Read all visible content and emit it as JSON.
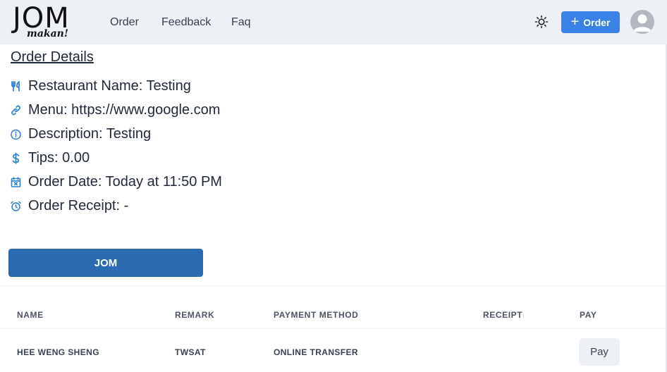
{
  "brand": {
    "logo_main": "JOM",
    "logo_sub": "makan!"
  },
  "nav": {
    "links": [
      "Order",
      "Feedback",
      "Faq"
    ]
  },
  "header": {
    "order_button": "Order",
    "plus": "+"
  },
  "colors": {
    "primary": "#3b82e6",
    "jom_button": "#2a6ab0",
    "icon_blue": "#2a7fd4",
    "navbar_bg": "#edf1f6"
  },
  "details": {
    "title": "Order Details",
    "rows": [
      {
        "icon": "fork-knife-icon",
        "text": "Restaurant Name: Testing"
      },
      {
        "icon": "link-icon",
        "text": "Menu: https://www.google.com"
      },
      {
        "icon": "info-icon",
        "text": "Description: Testing"
      },
      {
        "icon": "dollar-icon",
        "text": "Tips: 0.00"
      },
      {
        "icon": "calendar-icon",
        "text": "Order Date: Today at 11:50 PM"
      },
      {
        "icon": "alarm-clock-icon",
        "text": "Order Receipt: -"
      }
    ]
  },
  "jom_button": "JOM",
  "table": {
    "headers": [
      "NAME",
      "REMARK",
      "PAYMENT METHOD",
      "RECEIPT",
      "PAY"
    ],
    "rows": [
      {
        "name": "HEE WENG SHENG",
        "remark": "TWSAT",
        "payment_method": "ONLINE TRANSFER",
        "receipt": "",
        "pay_label": "Pay"
      }
    ]
  }
}
